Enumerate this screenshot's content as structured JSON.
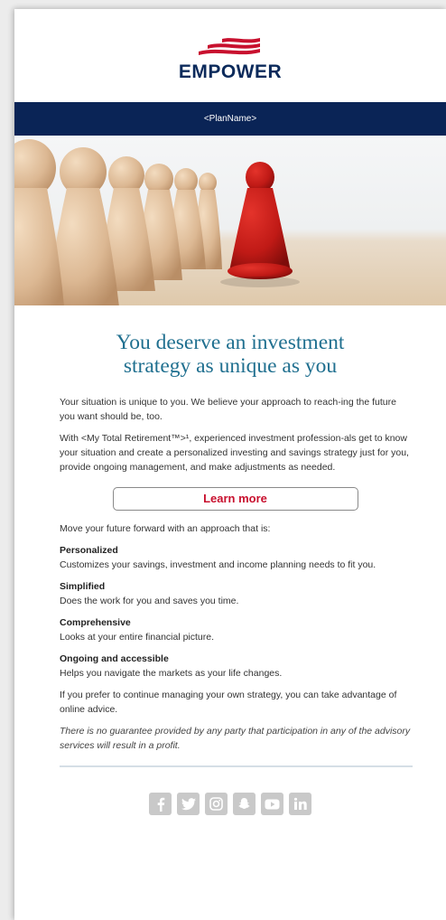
{
  "brand": {
    "name": "EMPOWER",
    "color_navy": "#0a2456",
    "color_red": "#c8102e"
  },
  "plan_bar": {
    "text": "<PlanName>"
  },
  "headline": {
    "line1": "You deserve an investment",
    "line2": "strategy as unique as you"
  },
  "body": {
    "p1": "Your situation is unique to you. We believe your approach to reach-ing the future you want should be, too.",
    "p2": "With <My Total Retirement™>¹, experienced investment profession-als get to know your situation and create a personalized investing and savings strategy just for you, provide ongoing management, and make adjustments as needed.",
    "cta_label": "Learn more",
    "lead_in": "Move your future forward with an approach that is:",
    "features": [
      {
        "title": "Personalized",
        "desc": "Customizes your savings, investment and income planning needs to fit you."
      },
      {
        "title": "Simplified",
        "desc": "Does the work for you and saves you time."
      },
      {
        "title": "Comprehensive",
        "desc": "Looks at your entire financial picture."
      },
      {
        "title": "Ongoing and accessible",
        "desc": "Helps you navigate the markets as your life changes."
      }
    ],
    "p3": "If you prefer to continue managing your own strategy, you can take advantage of online advice.",
    "disclaimer": "There is no guarantee provided by any party that participation in any of the advisory services will result in a profit."
  },
  "social_icons": [
    "facebook-icon",
    "twitter-icon",
    "instagram-icon",
    "snapchat-icon",
    "youtube-icon",
    "linkedin-icon"
  ]
}
